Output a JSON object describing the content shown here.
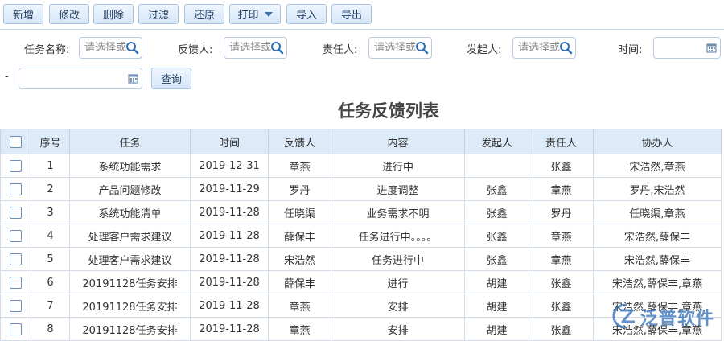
{
  "toolbar": {
    "buttons": [
      "新增",
      "修改",
      "删除",
      "过滤",
      "还原",
      "打印",
      "导入",
      "导出"
    ]
  },
  "filters": {
    "task_name_label": "任务名称:",
    "feedback_label": "反馈人:",
    "responsible_label": "责任人:",
    "initiator_label": "发起人:",
    "time_label": "时间:",
    "placeholder": "请选择或",
    "range_dash": "-",
    "search_label": "查询"
  },
  "page_title": "任务反馈列表",
  "table": {
    "columns": [
      "序号",
      "任务",
      "时间",
      "反馈人",
      "内容",
      "发起人",
      "责任人",
      "协办人"
    ],
    "rows": [
      [
        "1",
        "系统功能需求",
        "2019-12-31",
        "章燕",
        "进行中",
        "",
        "张鑫",
        "宋浩然,章燕"
      ],
      [
        "2",
        "产品问题修改",
        "2019-11-29",
        "罗丹",
        "进度调整",
        "张鑫",
        "章燕",
        "罗丹,宋浩然"
      ],
      [
        "3",
        "系统功能清单",
        "2019-11-28",
        "任晓渠",
        "业务需求不明",
        "张鑫",
        "罗丹",
        "任晓渠,章燕"
      ],
      [
        "4",
        "处理客户需求建议",
        "2019-11-28",
        "薛保丰",
        "任务进行中。。。。",
        "张鑫",
        "章燕",
        "宋浩然,薛保丰"
      ],
      [
        "5",
        "处理客户需求建议",
        "2019-11-28",
        "宋浩然",
        "任务进行中",
        "张鑫",
        "章燕",
        "宋浩然,薛保丰"
      ],
      [
        "6",
        "20191128任务安排",
        "2019-11-28",
        "薛保丰",
        "进行",
        "胡建",
        "张鑫",
        "宋浩然,薛保丰,章燕"
      ],
      [
        "7",
        "20191128任务安排",
        "2019-11-28",
        "章燕",
        "安排",
        "胡建",
        "张鑫",
        "宋浩然,薛保丰,章燕"
      ],
      [
        "8",
        "20191128任务安排",
        "2019-11-28",
        "章燕",
        "安排",
        "胡建",
        "张鑫",
        "宋浩然,薛保丰,章燕"
      ]
    ]
  },
  "watermark": {
    "text": "泛普软件"
  },
  "colors": {
    "accent": "#2b6cb0",
    "header_bg": "#ddeaf7",
    "button_bg": "#d6e6f8"
  }
}
